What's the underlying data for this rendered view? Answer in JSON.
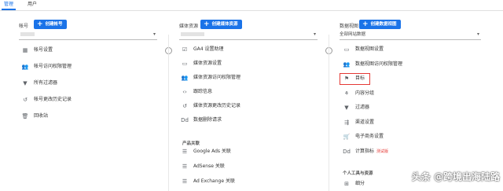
{
  "tabs": [
    "管理",
    "用户"
  ],
  "account": {
    "title": "帐号",
    "create_label": "创建帐号",
    "items": [
      {
        "icon": "building-icon",
        "glyph": "▦",
        "label": "帐号设置"
      },
      {
        "icon": "people-icon",
        "glyph": "👥",
        "label": "帐号访问权限管理"
      },
      {
        "icon": "filter-icon",
        "glyph": "▼",
        "label": "所有过滤器"
      },
      {
        "icon": "history-icon",
        "glyph": "↺",
        "label": "帐号更改历史记录"
      },
      {
        "icon": "trash-icon",
        "glyph": "🗑",
        "label": "回收站"
      }
    ]
  },
  "property": {
    "title": "媒体资源",
    "create_label": "创建媒体资源",
    "items": [
      {
        "icon": "checklist-icon",
        "glyph": "☑",
        "label": "GA4 设置助理"
      },
      {
        "icon": "window-icon",
        "glyph": "▭",
        "label": "媒体资源设置"
      },
      {
        "icon": "people-icon",
        "glyph": "👥",
        "label": "媒体资源访问权限管理"
      },
      {
        "icon": "code-icon",
        "glyph": "‹›",
        "label": "跟踪信息"
      },
      {
        "icon": "history-icon",
        "glyph": "↺",
        "label": "媒体资源更改历史记录"
      },
      {
        "icon": "dd-icon",
        "glyph": "Dd",
        "label": "数据删除请求"
      }
    ],
    "section_label": "产品关联",
    "product_links": [
      {
        "icon": "list-icon",
        "glyph": "☰",
        "label": "Google Ads 关联"
      },
      {
        "icon": "list-icon",
        "glyph": "☰",
        "label": "AdSense 关联"
      },
      {
        "icon": "list-icon",
        "glyph": "☰",
        "label": "Ad Exchange 关联"
      }
    ]
  },
  "view": {
    "title": "数据视图",
    "create_label": "创建数据视图",
    "select_value": "全部网站数据",
    "items": [
      {
        "icon": "window-icon",
        "glyph": "▭",
        "label": "数据视图设置"
      },
      {
        "icon": "people-icon",
        "glyph": "👥",
        "label": "数据视图访问权限管理"
      },
      {
        "icon": "flag-icon",
        "glyph": "⚑",
        "label": "目标"
      },
      {
        "icon": "content-grouping-icon",
        "glyph": "⚘",
        "label": "内容分组"
      },
      {
        "icon": "filter-icon",
        "glyph": "▼",
        "label": "过滤器"
      },
      {
        "icon": "channel-icon",
        "glyph": "⇶",
        "label": "渠道设置"
      },
      {
        "icon": "cart-icon",
        "glyph": "🛒",
        "label": "电子商务设置"
      },
      {
        "icon": "dd-icon",
        "glyph": "Dd",
        "label": "计算指标"
      }
    ],
    "beta_label": "测试版",
    "section_label": "个人工具与资源",
    "personal_items": [
      {
        "icon": "segment-icon",
        "glyph": "⊞",
        "label": "细分"
      }
    ]
  },
  "watermark": "头条 @跨境出海陆路"
}
